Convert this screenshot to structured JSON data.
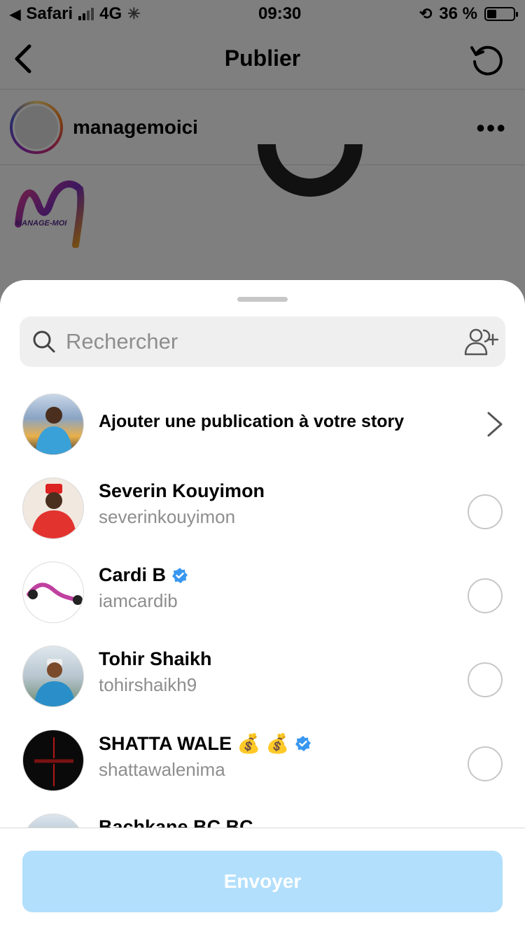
{
  "status_bar": {
    "carrier": "Safari",
    "network": "4G",
    "time": "09:30",
    "battery_percent": "36 %",
    "battery_level": 0.36
  },
  "nav": {
    "title": "Publier",
    "back_icon": "chevron-left-icon",
    "refresh_icon": "refresh-icon"
  },
  "post": {
    "username": "managemoici",
    "more_icon": "ellipsis-icon",
    "logo_text": "MANAGE-MOI"
  },
  "share_sheet": {
    "search": {
      "placeholder": "Rechercher",
      "icon": "search-icon",
      "add_people_icon": "add-people-icon"
    },
    "story_row": {
      "label": "Ajouter une publication à votre story",
      "icon": "chevron-right-icon"
    },
    "contacts": [
      {
        "name": "Severin Kouyimon",
        "handle": "severinkouyimon",
        "verified": false
      },
      {
        "name": "Cardi B",
        "handle": "iamcardib",
        "verified": true
      },
      {
        "name": "Tohir Shaikh",
        "handle": "tohirshaikh9",
        "verified": false
      },
      {
        "name": "SHATTA WALE 💰 💰",
        "handle": "shattawalenima",
        "verified": true
      },
      {
        "name": "Bachkane BC BC",
        "handle": "",
        "verified": false
      }
    ],
    "send_label": "Envoyer"
  },
  "colors": {
    "accent_disabled": "#b2dffc",
    "verified_blue": "#3897f0",
    "secondary_text": "#8e8e8e"
  }
}
